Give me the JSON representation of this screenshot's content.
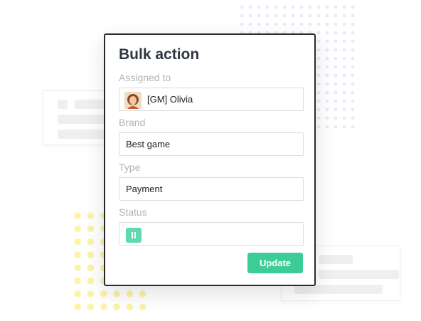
{
  "panel": {
    "title": "Bulk action",
    "assigned": {
      "label": "Assigned to",
      "value": "[GM] Olivia",
      "avatar_icon": "user-avatar"
    },
    "brand": {
      "label": "Brand",
      "value": "Best game"
    },
    "type": {
      "label": "Type",
      "value": "Payment"
    },
    "status": {
      "label": "Status",
      "icon": "pause-icon",
      "color": "#5fd9ae"
    },
    "update_label": "Update"
  },
  "colors": {
    "accent": "#3ccc97",
    "border": "#2b2b2b",
    "decor_dots_yellow": "#fbf3a8",
    "decor_dots_lilac": "#ece6fb"
  }
}
